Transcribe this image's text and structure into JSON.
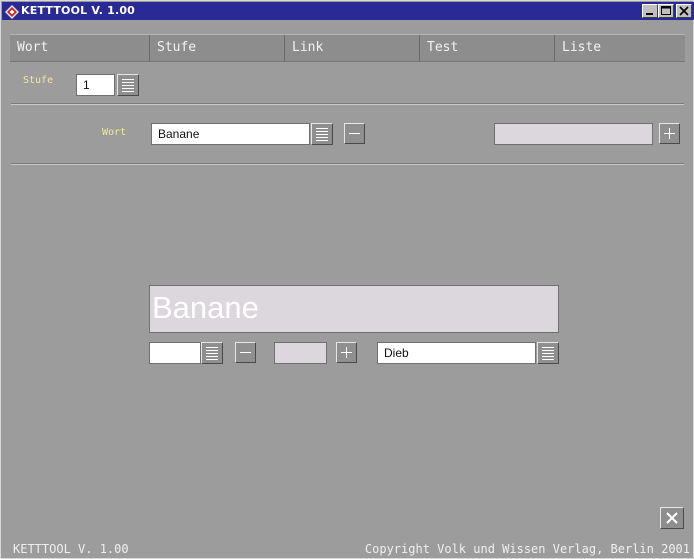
{
  "window": {
    "title": "KETTTOOL V. 1.00",
    "controls": [
      "minimize",
      "maximize",
      "close"
    ]
  },
  "tabs": [
    {
      "label": "Wort"
    },
    {
      "label": "Stufe"
    },
    {
      "label": "Link"
    },
    {
      "label": "Test"
    },
    {
      "label": "Liste"
    }
  ],
  "stufe": {
    "label": "Stufe",
    "value": "1"
  },
  "wort_row": {
    "label": "Wort",
    "value": "Banane",
    "right_field_value": ""
  },
  "display": {
    "word": "Banane"
  },
  "link_row": {
    "left_value": "",
    "middle_value": "",
    "right_value": "Dieb"
  },
  "statusbar": {
    "left": "KETTTOOL V. 1.00",
    "right": "Copyright Volk und Wissen Verlag, Berlin 2001"
  },
  "colors": {
    "titlebar": "#2a2a96",
    "background": "#9c9c9c",
    "label_yellow": "#f0ea9a",
    "field_lavender": "#dcd6dd"
  }
}
